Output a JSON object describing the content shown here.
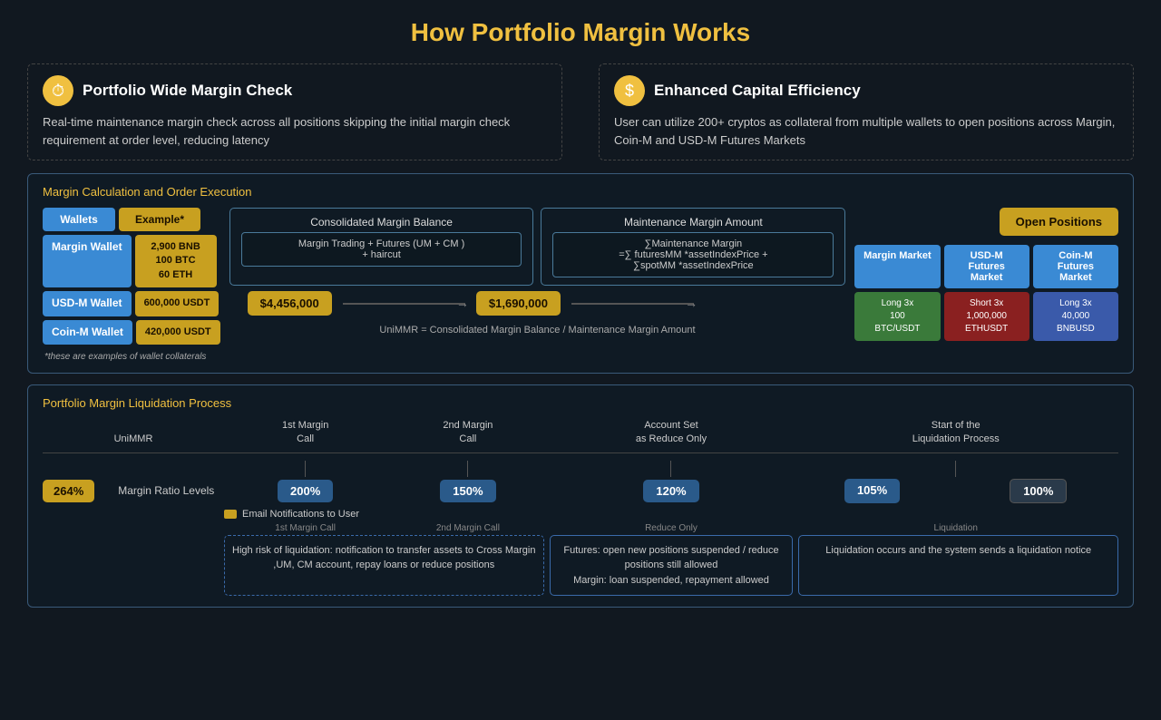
{
  "page": {
    "title": "How Portfolio Margin Works",
    "background_color": "#111820"
  },
  "left_feature": {
    "icon": "⏱",
    "title": "Portfolio Wide Margin Check",
    "description": "Real-time maintenance margin check across all positions skipping the initial margin check requirement at order level, reducing latency"
  },
  "right_feature": {
    "icon": "$",
    "title": "Enhanced Capital Efficiency",
    "description": "User can utilize 200+ cryptos as collateral from multiple wallets to open positions across Margin, Coin-M and USD-M Futures Markets"
  },
  "calc_section": {
    "title": "Margin Calculation and Order Execution",
    "wallets_header": "Wallets",
    "example_header": "Example*",
    "wallets": [
      {
        "name": "Margin Wallet",
        "value": "2,900 BNB\n100 BTC\n60 ETH"
      },
      {
        "name": "USD-M Wallet",
        "value": "600,000 USDT"
      },
      {
        "name": "Coin-M Wallet",
        "value": "420,000 USDT"
      }
    ],
    "wallet_note": "*these are examples of wallet collaterals",
    "consolidated_label": "Consolidated Margin Balance",
    "consolidated_formula": "Margin Trading + Futures (UM + CM )\n+ haircut",
    "maintenance_label": "Maintenance Margin Amount",
    "maintenance_formula": "∑Maintenance Margin\n=∑ futuresMM *assetIndexPrice +\n∑spotMM *assetIndexPrice",
    "balance_amount": "$4,456,000",
    "maintenance_amount": "$1,690,000",
    "open_positions_label": "Open Positions",
    "unimmr_text": "UniMMR = Consolidated Margin Balance / Maintenance Margin Amount",
    "markets": {
      "headers": [
        "Margin Market",
        "USD-M Futures\nMarket",
        "Coin-M Futures\nMarket"
      ],
      "positions": [
        {
          "label": "Long 3x\n100\nBTC/USDT",
          "type": "green"
        },
        {
          "label": "Short 3x\n1,000,000\nETHUSDT",
          "type": "red"
        },
        {
          "label": "Long 3x\n40,000\nBNBUSD",
          "type": "blue"
        }
      ]
    }
  },
  "liq_section": {
    "title": "Portfolio Margin Liquidation Process",
    "headers": [
      "UniMMR",
      "1st Margin\nCall",
      "2nd Margin\nCall",
      "Account Set\nas Reduce Only",
      "Start of the\nLiquidation Process"
    ],
    "current_ratio": "264%",
    "ratio_label": "Margin Ratio Levels",
    "levels": [
      "200%",
      "150%",
      "120%",
      "105%",
      "100%"
    ],
    "email_label": "Email Notifications to User",
    "labels": [
      "1st Margin Call",
      "2nd Margin Call",
      "Reduce Only",
      "Liquidation"
    ],
    "descriptions": [
      "High risk of liquidation: notification to transfer assets to Cross Margin ,UM, CM account, repay loans or reduce positions",
      "Futures: open new positions suspended / reduce positions still allowed\nMargin: loan suspended, repayment allowed",
      "Liquidation occurs and the system sends a liquidation notice"
    ]
  }
}
